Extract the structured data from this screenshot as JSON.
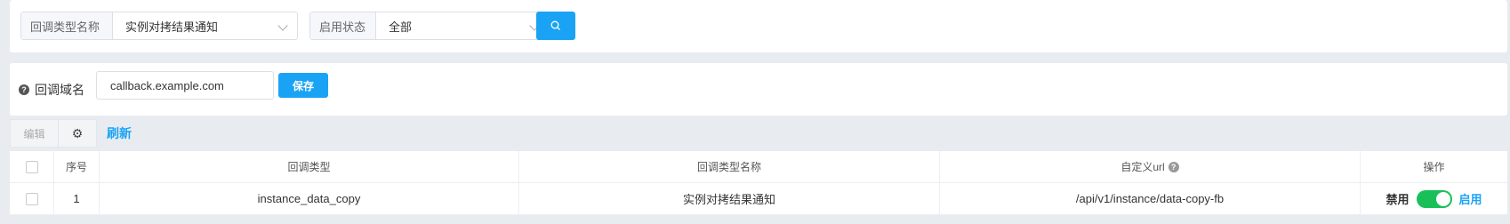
{
  "filters": [
    {
      "label": "回调类型名称",
      "value": "实例对拷结果通知"
    },
    {
      "label": "启用状态",
      "value": "全部"
    }
  ],
  "domain": {
    "label": "回调域名",
    "value": "callback.example.com",
    "save_label": "保存"
  },
  "toolbar": {
    "edit_label": "编辑",
    "refresh_label": "刷新"
  },
  "table": {
    "headers": [
      "序号",
      "回调类型",
      "回调类型名称",
      "自定义url",
      "操作"
    ],
    "rows": [
      {
        "index": "1",
        "type": "instance_data_copy",
        "type_name": "实例对拷结果通知",
        "url": "/api/v1/instance/data-copy-fb",
        "disable_label": "禁用",
        "enable_label": "启用",
        "enabled": true
      }
    ]
  },
  "colors": {
    "primary": "#1aa3f5",
    "toggle_on": "#19c05a"
  }
}
